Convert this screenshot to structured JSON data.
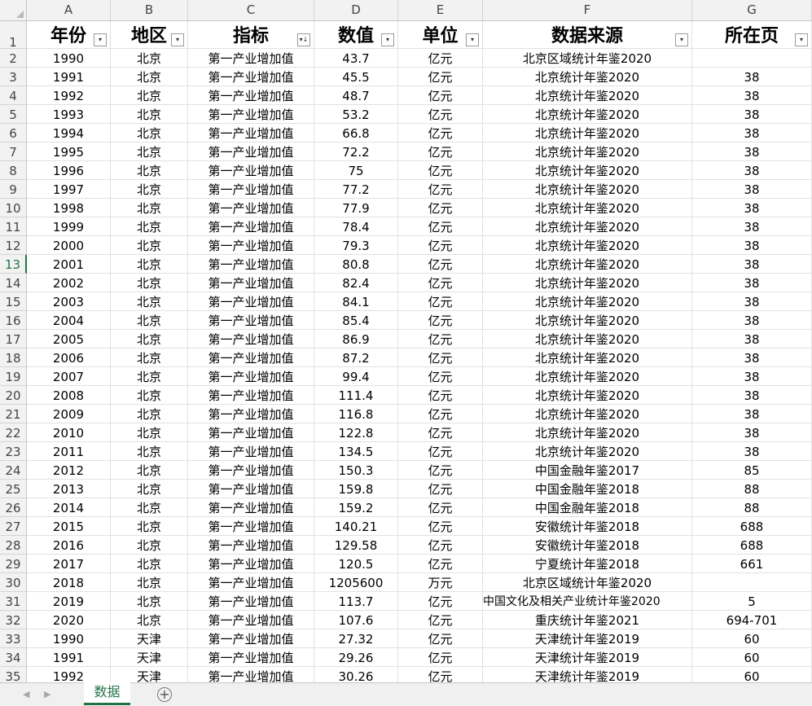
{
  "columns": [
    "A",
    "B",
    "C",
    "D",
    "E",
    "F",
    "G"
  ],
  "headers": [
    "年份",
    "地区",
    "指标",
    "数值",
    "单位",
    "数据来源",
    "所在页"
  ],
  "sheet_tab": "数据",
  "icons": {
    "filter": "▾",
    "sorted_filter": "▾↓",
    "nav_prev": "◀",
    "nav_next": "▶",
    "add_sheet": "+"
  },
  "rows": [
    {
      "n": "2",
      "c": [
        "1990",
        "北京",
        "第一产业增加值",
        "43.7",
        "亿元",
        "北京区域统计年鉴2020",
        ""
      ]
    },
    {
      "n": "3",
      "c": [
        "1991",
        "北京",
        "第一产业增加值",
        "45.5",
        "亿元",
        "北京统计年鉴2020",
        "38"
      ]
    },
    {
      "n": "4",
      "c": [
        "1992",
        "北京",
        "第一产业增加值",
        "48.7",
        "亿元",
        "北京统计年鉴2020",
        "38"
      ]
    },
    {
      "n": "5",
      "c": [
        "1993",
        "北京",
        "第一产业增加值",
        "53.2",
        "亿元",
        "北京统计年鉴2020",
        "38"
      ]
    },
    {
      "n": "6",
      "c": [
        "1994",
        "北京",
        "第一产业增加值",
        "66.8",
        "亿元",
        "北京统计年鉴2020",
        "38"
      ]
    },
    {
      "n": "7",
      "c": [
        "1995",
        "北京",
        "第一产业增加值",
        "72.2",
        "亿元",
        "北京统计年鉴2020",
        "38"
      ]
    },
    {
      "n": "8",
      "c": [
        "1996",
        "北京",
        "第一产业增加值",
        "75",
        "亿元",
        "北京统计年鉴2020",
        "38"
      ]
    },
    {
      "n": "9",
      "c": [
        "1997",
        "北京",
        "第一产业增加值",
        "77.2",
        "亿元",
        "北京统计年鉴2020",
        "38"
      ]
    },
    {
      "n": "10",
      "c": [
        "1998",
        "北京",
        "第一产业增加值",
        "77.9",
        "亿元",
        "北京统计年鉴2020",
        "38"
      ]
    },
    {
      "n": "11",
      "c": [
        "1999",
        "北京",
        "第一产业增加值",
        "78.4",
        "亿元",
        "北京统计年鉴2020",
        "38"
      ]
    },
    {
      "n": "12",
      "c": [
        "2000",
        "北京",
        "第一产业增加值",
        "79.3",
        "亿元",
        "北京统计年鉴2020",
        "38"
      ]
    },
    {
      "n": "13",
      "c": [
        "2001",
        "北京",
        "第一产业增加值",
        "80.8",
        "亿元",
        "北京统计年鉴2020",
        "38"
      ]
    },
    {
      "n": "14",
      "c": [
        "2002",
        "北京",
        "第一产业增加值",
        "82.4",
        "亿元",
        "北京统计年鉴2020",
        "38"
      ]
    },
    {
      "n": "15",
      "c": [
        "2003",
        "北京",
        "第一产业增加值",
        "84.1",
        "亿元",
        "北京统计年鉴2020",
        "38"
      ]
    },
    {
      "n": "16",
      "c": [
        "2004",
        "北京",
        "第一产业增加值",
        "85.4",
        "亿元",
        "北京统计年鉴2020",
        "38"
      ]
    },
    {
      "n": "17",
      "c": [
        "2005",
        "北京",
        "第一产业增加值",
        "86.9",
        "亿元",
        "北京统计年鉴2020",
        "38"
      ]
    },
    {
      "n": "18",
      "c": [
        "2006",
        "北京",
        "第一产业增加值",
        "87.2",
        "亿元",
        "北京统计年鉴2020",
        "38"
      ]
    },
    {
      "n": "19",
      "c": [
        "2007",
        "北京",
        "第一产业增加值",
        "99.4",
        "亿元",
        "北京统计年鉴2020",
        "38"
      ]
    },
    {
      "n": "20",
      "c": [
        "2008",
        "北京",
        "第一产业增加值",
        "111.4",
        "亿元",
        "北京统计年鉴2020",
        "38"
      ]
    },
    {
      "n": "21",
      "c": [
        "2009",
        "北京",
        "第一产业增加值",
        "116.8",
        "亿元",
        "北京统计年鉴2020",
        "38"
      ]
    },
    {
      "n": "22",
      "c": [
        "2010",
        "北京",
        "第一产业增加值",
        "122.8",
        "亿元",
        "北京统计年鉴2020",
        "38"
      ]
    },
    {
      "n": "23",
      "c": [
        "2011",
        "北京",
        "第一产业增加值",
        "134.5",
        "亿元",
        "北京统计年鉴2020",
        "38"
      ]
    },
    {
      "n": "24",
      "c": [
        "2012",
        "北京",
        "第一产业增加值",
        "150.3",
        "亿元",
        "中国金融年鉴2017",
        "85"
      ]
    },
    {
      "n": "25",
      "c": [
        "2013",
        "北京",
        "第一产业增加值",
        "159.8",
        "亿元",
        "中国金融年鉴2018",
        "88"
      ]
    },
    {
      "n": "26",
      "c": [
        "2014",
        "北京",
        "第一产业增加值",
        "159.2",
        "亿元",
        "中国金融年鉴2018",
        "88"
      ]
    },
    {
      "n": "27",
      "c": [
        "2015",
        "北京",
        "第一产业增加值",
        "140.21",
        "亿元",
        "安徽统计年鉴2018",
        "688"
      ]
    },
    {
      "n": "28",
      "c": [
        "2016",
        "北京",
        "第一产业增加值",
        "129.58",
        "亿元",
        "安徽统计年鉴2018",
        "688"
      ]
    },
    {
      "n": "29",
      "c": [
        "2017",
        "北京",
        "第一产业增加值",
        "120.5",
        "亿元",
        "宁夏统计年鉴2018",
        "661"
      ]
    },
    {
      "n": "30",
      "c": [
        "2018",
        "北京",
        "第一产业增加值",
        "1205600",
        "万元",
        "北京区域统计年鉴2020",
        ""
      ]
    },
    {
      "n": "31",
      "c": [
        "2019",
        "北京",
        "第一产业增加值",
        "113.7",
        "亿元",
        "中国文化及相关产业统计年鉴2020",
        "5"
      ]
    },
    {
      "n": "32",
      "c": [
        "2020",
        "北京",
        "第一产业增加值",
        "107.6",
        "亿元",
        "重庆统计年鉴2021",
        "694-701"
      ]
    },
    {
      "n": "33",
      "c": [
        "1990",
        "天津",
        "第一产业增加值",
        "27.32",
        "亿元",
        "天津统计年鉴2019",
        "60"
      ]
    },
    {
      "n": "34",
      "c": [
        "1991",
        "天津",
        "第一产业增加值",
        "29.26",
        "亿元",
        "天津统计年鉴2019",
        "60"
      ]
    },
    {
      "n": "35",
      "c": [
        "1992",
        "天津",
        "第一产业增加值",
        "30.26",
        "亿元",
        "天津统计年鉴2019",
        "60"
      ]
    }
  ]
}
